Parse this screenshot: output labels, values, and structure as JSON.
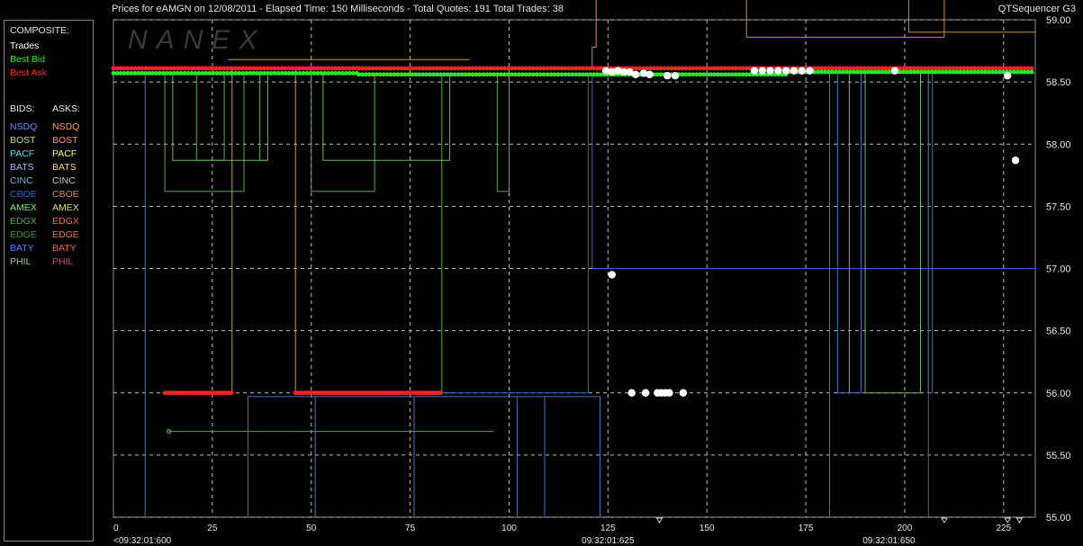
{
  "header": {
    "title": "Prices for  eAMGN  on  12/08/2011  -  Elapsed Time: 150 Milliseconds  -  Total Quotes: 191  Total Trades: 38",
    "brand": "QTSequencer G3",
    "watermark": "NANEX"
  },
  "legend": {
    "composite_label": "COMPOSITE:",
    "composite_items": [
      {
        "label": "Trades",
        "color": "#ffffff"
      },
      {
        "label": "Best Bid",
        "color": "#22ee22"
      },
      {
        "label": "Best Ask",
        "color": "#ff2222"
      }
    ],
    "bids_label": "BIDS:",
    "asks_label": "ASKS:",
    "exchanges": [
      {
        "bid": "NSDQ",
        "ask": "NSDQ",
        "bid_color": "#5c8cff",
        "ask_color": "#ff9a55"
      },
      {
        "bid": "BOST",
        "ask": "BOST",
        "bid_color": "#bfe07a",
        "ask_color": "#ff8a7a"
      },
      {
        "bid": "PACF",
        "ask": "PACF",
        "bid_color": "#3fe6ff",
        "ask_color": "#ffff55"
      },
      {
        "bid": "BATS",
        "ask": "BATS",
        "bid_color": "#9ab6ff",
        "ask_color": "#ffd47a"
      },
      {
        "bid": "CINC",
        "ask": "CINC",
        "bid_color": "#66b0c8",
        "ask_color": "#c8c8c8"
      },
      {
        "bid": "CBOE",
        "ask": "CBOE",
        "bid_color": "#2f66c8",
        "ask_color": "#d09040"
      },
      {
        "bid": "AMEX",
        "ask": "AMEX",
        "bid_color": "#55ff55",
        "ask_color": "#e0e060"
      },
      {
        "bid": "EDGX",
        "ask": "EDGX",
        "bid_color": "#55aa55",
        "ask_color": "#ff6a3a"
      },
      {
        "bid": "EDGE",
        "ask": "EDGE",
        "bid_color": "#2fa02f",
        "ask_color": "#e07a3a"
      },
      {
        "bid": "BATY",
        "ask": "BATY",
        "bid_color": "#5a7aff",
        "ask_color": "#ff5a5a"
      },
      {
        "bid": "PHIL",
        "ask": "PHIL",
        "bid_color": "#9ad07a",
        "ask_color": "#d04a7a"
      }
    ]
  },
  "chart_data": {
    "type": "scatter",
    "x_axis": {
      "range": [
        0,
        233
      ],
      "ticks": [
        0,
        25,
        50,
        75,
        100,
        125,
        150,
        175,
        200,
        225
      ],
      "time_labels": [
        {
          "x": 0,
          "label": "<09:32:01:600"
        },
        {
          "x": 125,
          "label": "09:32:01:625"
        },
        {
          "x": 196,
          "label": "09:32:01:650"
        }
      ]
    },
    "y_axis": {
      "range": [
        55.0,
        59.0
      ],
      "ticks": [
        "55.00",
        "55.50",
        "56.00",
        "56.50",
        "57.00",
        "57.50",
        "58.00",
        "58.50",
        "59.00"
      ]
    },
    "grid": true,
    "series": [
      {
        "name": "Trades",
        "color": "#ffffff",
        "points": [
          [
            124.5,
            58.59
          ],
          [
            126,
            58.58
          ],
          [
            127.5,
            58.59
          ],
          [
            129,
            58.58
          ],
          [
            130.5,
            58.58
          ],
          [
            132,
            58.56
          ],
          [
            134,
            58.57
          ],
          [
            135.5,
            58.56
          ],
          [
            140,
            58.55
          ],
          [
            142,
            58.55
          ],
          [
            162,
            58.59
          ],
          [
            164,
            58.59
          ],
          [
            166,
            58.59
          ],
          [
            168,
            58.59
          ],
          [
            170,
            58.59
          ],
          [
            172,
            58.59
          ],
          [
            174,
            58.59
          ],
          [
            176,
            58.59
          ],
          [
            197.5,
            58.59
          ],
          [
            226,
            58.55
          ],
          [
            228,
            57.87
          ],
          [
            126,
            56.95
          ],
          [
            131,
            56.0
          ],
          [
            134.5,
            56.0
          ],
          [
            137.5,
            56.0
          ],
          [
            138.5,
            56.0
          ],
          [
            139.5,
            56.0
          ],
          [
            140.5,
            56.0
          ],
          [
            144,
            56.0
          ]
        ]
      },
      {
        "name": "Best Bid",
        "color": "#22ee22",
        "segments": [
          [
            0,
            30,
            58.57
          ],
          [
            30,
            62,
            58.57
          ],
          [
            62,
            124,
            58.56
          ],
          [
            124,
            170,
            58.56
          ],
          [
            170,
            233,
            58.58
          ]
        ],
        "extra_points": [
          [
            14,
            55.69
          ]
        ]
      },
      {
        "name": "Best Ask",
        "color": "#ff2222",
        "segments": [
          [
            0,
            30,
            58.61
          ],
          [
            30,
            62,
            58.61
          ],
          [
            62,
            124,
            58.61
          ],
          [
            124,
            170,
            58.61
          ],
          [
            170,
            233,
            58.61
          ]
        ],
        "low_segments": [
          [
            13,
            30,
            56.0
          ],
          [
            46,
            83,
            56.0
          ]
        ]
      }
    ]
  }
}
